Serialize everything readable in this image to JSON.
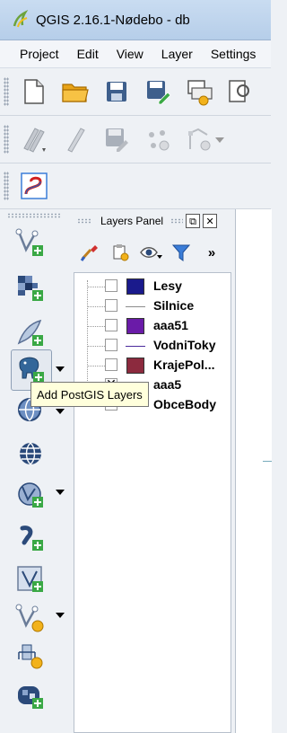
{
  "window": {
    "title": "QGIS 2.16.1-Nødebo - db"
  },
  "menubar": {
    "items": [
      "Project",
      "Edit",
      "View",
      "Layer",
      "Settings"
    ]
  },
  "layers_panel": {
    "title": "Layers Panel",
    "float_button": "⧉",
    "close_button": "✕",
    "more_button": "»",
    "layers": [
      {
        "name": "Lesy",
        "checked": false,
        "symbol": "fill",
        "color": "#1a1a8c"
      },
      {
        "name": "Silnice",
        "checked": false,
        "symbol": "line",
        "color": "#8c8c8c"
      },
      {
        "name": "aaa51",
        "checked": false,
        "symbol": "fill",
        "color": "#6a1ba8"
      },
      {
        "name": "VodniToky",
        "checked": false,
        "symbol": "line",
        "color": "#4a2a9c"
      },
      {
        "name": "KrajePol...",
        "checked": false,
        "symbol": "fill",
        "color": "#8c2a3e"
      },
      {
        "name": "aaa5",
        "checked": true,
        "symbol": "line",
        "color": "#2a8c6a"
      },
      {
        "name": "ObceBody",
        "checked": false,
        "symbol": "point",
        "color": "#888888"
      }
    ]
  },
  "tooltip": {
    "text": "Add PostGIS Layers"
  },
  "colors": {
    "accent": "#3b7dd8",
    "add_green": "#3aa845",
    "panel_bg": "#eef1f5"
  }
}
